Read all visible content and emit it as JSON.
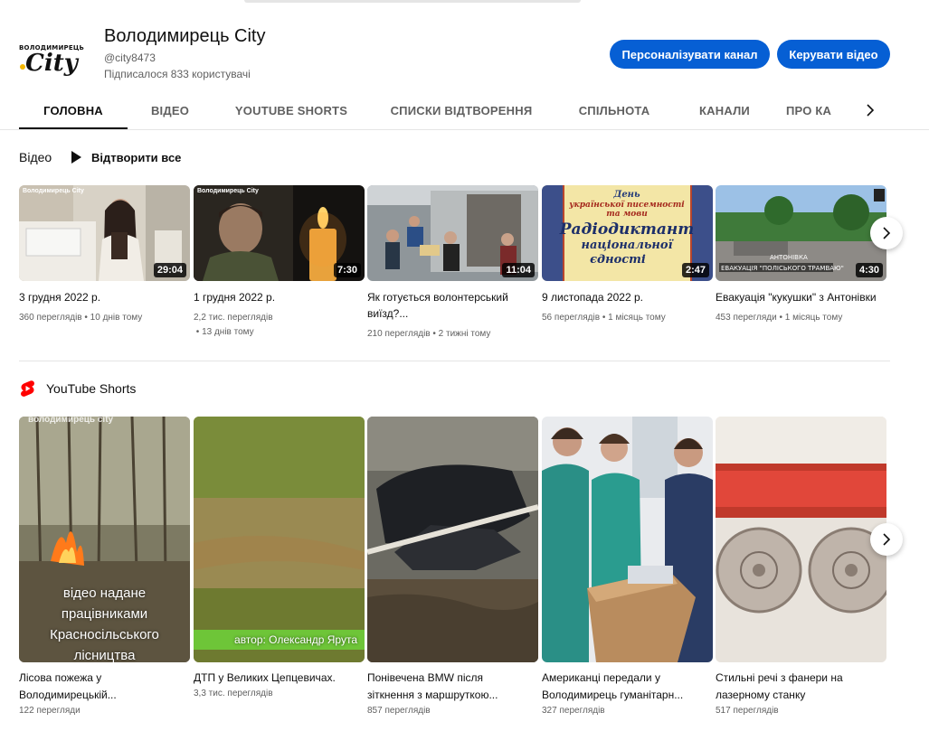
{
  "channel": {
    "logo_top": "ВОЛОДИМИРЕЦЬ",
    "logo_main": "City",
    "title": "Володимирець City",
    "handle": "@city8473",
    "subscribers": "Підписалося 833 користувачі",
    "customize_label": "Персоналізувати канал",
    "manage_label": "Керувати відео"
  },
  "tabs": [
    "Головна",
    "Відео",
    "YouTube Shorts",
    "Списки відтворення",
    "Спільнота",
    "Канали",
    "Про ка"
  ],
  "videos_shelf": {
    "title": "Відео",
    "play_all": "Відтворити все",
    "items": [
      {
        "title": "3 грудня 2022 р.",
        "views": "360 переглядів",
        "age": "10 днів тому",
        "duration": "29:04",
        "watermark": "Володимирець City"
      },
      {
        "title": "1 грудня 2022 р.",
        "views": "2,2 тис. переглядів",
        "age": "13 днів тому",
        "duration": "7:30",
        "watermark": "Володимирець City"
      },
      {
        "title": "Як готується волонтерський виїзд?...",
        "views": "210 переглядів",
        "age": "2 тижні тому",
        "duration": "11:04",
        "watermark": ""
      },
      {
        "title": "9 листопада 2022 р.",
        "views": "56 переглядів",
        "age": "1 місяць тому",
        "duration": "2:47",
        "watermark": "",
        "thumb_text": [
          "День",
          "української писемності",
          "та мови",
          "Радіодиктант",
          "національної",
          "єдності"
        ]
      },
      {
        "title": "Евакуація \"кукушки\" з Антонівки",
        "views": "453 перегляди",
        "age": "1 місяць тому",
        "duration": "4:30",
        "watermark": "",
        "thumb_text": [
          "АНТОНІВКА",
          "ЕВАКУАЦІЯ \"ПОЛІСЬКОГО ТРАМВАЮ\""
        ]
      }
    ]
  },
  "shorts_shelf": {
    "title": "YouTube Shorts",
    "items": [
      {
        "title": "Лісова пожежа у Володимирецькій...",
        "views": "122 перегляди",
        "overlay": [
          "відео надане",
          "працівниками",
          "Красносільського",
          "лісництва"
        ],
        "watermark": "володимирець city"
      },
      {
        "title": "ДТП у Великих Цепцевичах.",
        "views": "3,3 тис. переглядів",
        "overlay": [
          "автор: Олександр Ярута"
        ]
      },
      {
        "title": "Понівечена BMW після зіткнення з маршруткою...",
        "views": "857 переглядів"
      },
      {
        "title": "Американці передали у Володимирець гуманітарн...",
        "views": "327 переглядів"
      },
      {
        "title": "Стильні речі з фанери на лазерному станку",
        "views": "517 переглядів"
      }
    ]
  },
  "colors": {
    "accent": "#065fd4",
    "text_primary": "#0f0f0f",
    "text_secondary": "#606060",
    "shorts_red": "#ff0000"
  },
  "icons": {
    "play_all": "play-icon",
    "next": "chevron-right-icon",
    "shorts": "youtube-shorts-icon"
  }
}
